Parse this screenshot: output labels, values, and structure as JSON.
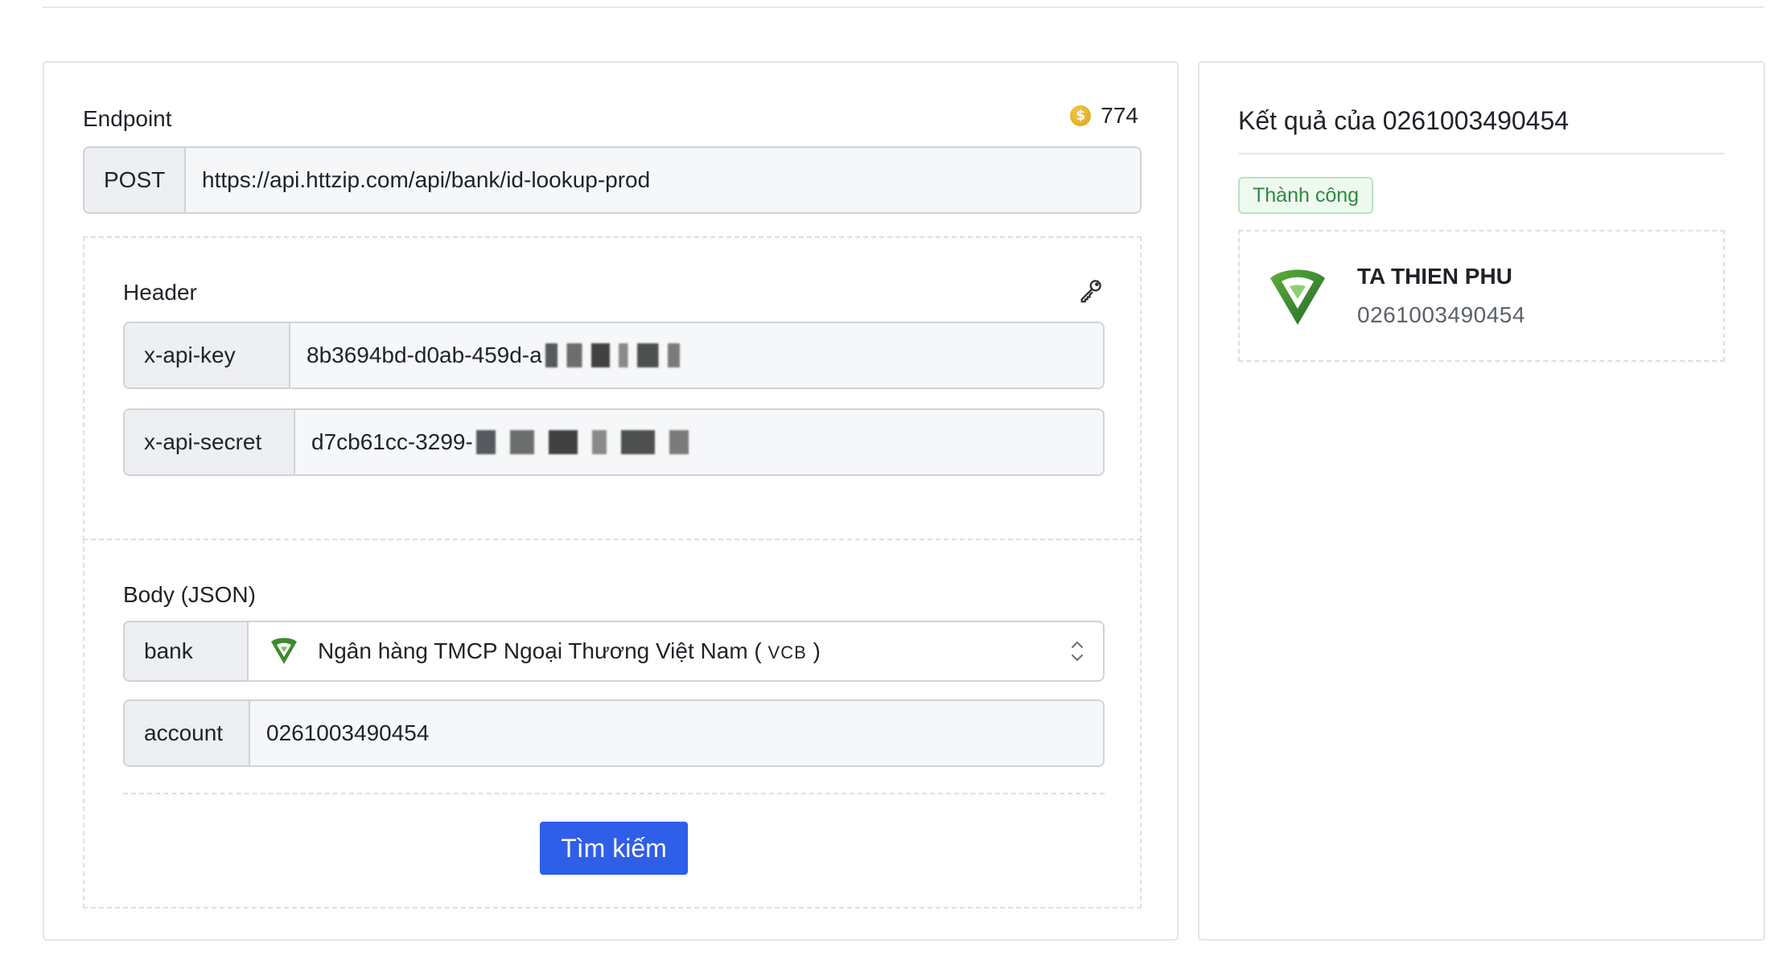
{
  "endpoint": {
    "label": "Endpoint",
    "credit": "774",
    "coin_icon": "dollar-coin-icon",
    "method": "POST",
    "url": "https://api.httzip.com/api/bank/id-lookup-prod"
  },
  "header": {
    "title": "Header",
    "icon": "key-icon",
    "api_key_label": "x-api-key",
    "api_key_value": "8b3694bd-d0ab-459d-a",
    "api_secret_label": "x-api-secret",
    "api_secret_value": "d7cb61cc-3299-"
  },
  "body": {
    "title": "Body (JSON)",
    "bank_label": "bank",
    "bank_name": "Ngân hàng TMCP Ngoại Thương Việt Nam ( ",
    "bank_code": "VCB",
    "bank_close": " )",
    "account_label": "account",
    "account_value": "0261003490454",
    "search_button": "Tìm kiếm"
  },
  "result": {
    "title": "Kết quả của 0261003490454",
    "status": "Thành công",
    "holder_name": "TA THIEN PHU",
    "holder_account": "0261003490454"
  },
  "colors": {
    "primary": "#2f5ee8",
    "success": "#2e8a3f",
    "vcb_green": "#3c8a2e"
  }
}
